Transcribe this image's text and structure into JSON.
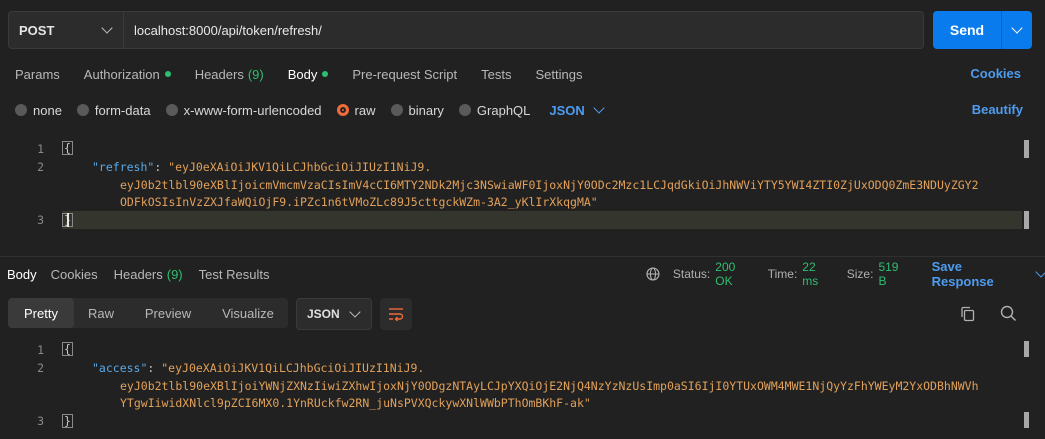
{
  "request": {
    "method": "POST",
    "url": "localhost:8000/api/token/refresh/",
    "send_label": "Send"
  },
  "request_tabs": {
    "params": "Params",
    "authorization": "Authorization",
    "headers": "Headers",
    "headers_count": "(9)",
    "body": "Body",
    "pre_request": "Pre-request Script",
    "tests": "Tests",
    "settings": "Settings",
    "cookies": "Cookies"
  },
  "body_types": {
    "none": "none",
    "form_data": "form-data",
    "urlencoded": "x-www-form-urlencoded",
    "raw": "raw",
    "binary": "binary",
    "graphql": "GraphQL",
    "language": "JSON",
    "beautify": "Beautify"
  },
  "request_body": {
    "line_numbers": [
      "1",
      "2",
      "3"
    ],
    "open_brace": "{",
    "close_brace": "}",
    "key": "\"refresh\"",
    "value_line1": "\"eyJ0eXAiOiJKV1QiLCJhbGciOiJIUzI1NiJ9.",
    "value_line2": "eyJ0b2tlbl90eXBlIjoicmVmcmVzaCIsImV4cCI6MTY2NDk2Mjc3NSwiaWF0IjoxNjY0ODc2Mzc1LCJqdGkiOiJhNWViYTY5YWI4ZTI0ZjUxODQ0ZmE3NDUyZGY2",
    "value_line3": "ODFkOSIsInVzZXJfaWQiOjF9.iPZc1n6tVMoZLc89J5cttgckWZm-3A2_yKlIrXkqgMA\""
  },
  "response_tabs": {
    "body": "Body",
    "cookies": "Cookies",
    "headers": "Headers",
    "headers_count": "(9)",
    "test_results": "Test Results"
  },
  "response_meta": {
    "status_label": "Status:",
    "status_value": "200 OK",
    "time_label": "Time:",
    "time_value": "22 ms",
    "size_label": "Size:",
    "size_value": "519 B",
    "save_response": "Save Response"
  },
  "response_view": {
    "pretty": "Pretty",
    "raw": "Raw",
    "preview": "Preview",
    "visualize": "Visualize",
    "language": "JSON"
  },
  "response_body": {
    "line_numbers": [
      "1",
      "2",
      "3"
    ],
    "open_brace": "{",
    "close_brace": "}",
    "key": "\"access\"",
    "value_line1": "\"eyJ0eXAiOiJKV1QiLCJhbGciOiJIUzI1NiJ9.",
    "value_line2": "eyJ0b2tlbl90eXBlIjoiYWNjZXNzIiwiZXhwIjoxNjY0ODgzNTAyLCJpYXQiOjE2NjQ4NzYzNzUsImp0aSI6IjI0YTUxOWM4MWE1NjQyYzFhYWEyM2YxODBhNWVh",
    "value_line3": "YTgwIiwidXNlcl9pZCI6MX0.1YnRUckfw2RN_juNsPVXQckywXNlWWbPThOmBKhF-ak\""
  },
  "colors": {
    "accent": "#097bed",
    "link": "#4d9cf0",
    "success": "#2fbf71",
    "json_key": "#5aa9e6",
    "json_string": "#e2a15a",
    "radio_selected": "#f26b3a"
  }
}
